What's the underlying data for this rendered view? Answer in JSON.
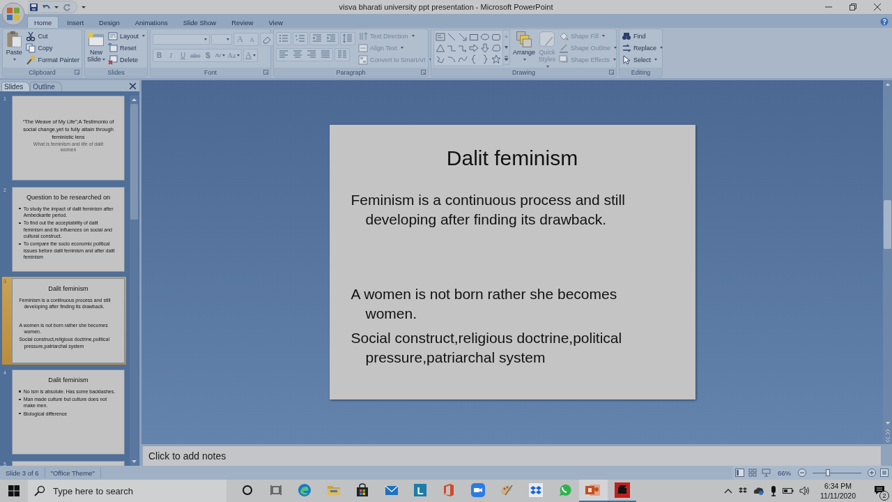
{
  "window": {
    "title": "visva bharati university ppt presentation - Microsoft PowerPoint"
  },
  "ribbon": {
    "tabs": [
      {
        "label": "Home",
        "selected": true
      },
      {
        "label": "Insert",
        "selected": false
      },
      {
        "label": "Design",
        "selected": false
      },
      {
        "label": "Animations",
        "selected": false
      },
      {
        "label": "Slide Show",
        "selected": false
      },
      {
        "label": "Review",
        "selected": false
      },
      {
        "label": "View",
        "selected": false
      }
    ],
    "groups": [
      {
        "name": "Clipboard",
        "kind": "plain",
        "commands": [
          {
            "label": "Paste",
            "kind": "large",
            "dropdown": true,
            "disabled": false
          },
          {
            "label": "Cut",
            "kind": "small",
            "dropdown": false,
            "disabled": false
          },
          {
            "label": "Copy",
            "kind": "small",
            "dropdown": false,
            "disabled": false
          },
          {
            "label": "Format Painter",
            "kind": "small",
            "dropdown": false,
            "disabled": false
          }
        ]
      },
      {
        "name": "Slides",
        "kind": "plain",
        "commands": [
          {
            "label": "New Slide",
            "kind": "large",
            "dropdown": true,
            "disabled": false
          },
          {
            "label": "Layout",
            "kind": "small",
            "dropdown": true,
            "disabled": false
          },
          {
            "label": "Reset",
            "kind": "small",
            "dropdown": false,
            "disabled": false
          },
          {
            "label": "Delete",
            "kind": "small",
            "dropdown": false,
            "disabled": false
          }
        ]
      },
      {
        "name": "Font",
        "kind": "font",
        "commands": [
          {
            "label": "A",
            "kind": "glyph",
            "dropdown": false,
            "disabled": true
          },
          {
            "label": "A",
            "kind": "glyph",
            "dropdown": false,
            "disabled": true
          },
          {
            "label": "B",
            "kind": "glyph",
            "dropdown": false,
            "disabled": true
          },
          {
            "label": "I",
            "kind": "glyph",
            "dropdown": false,
            "disabled": true
          },
          {
            "label": "U",
            "kind": "glyph",
            "dropdown": false,
            "disabled": true
          },
          {
            "label": "abc",
            "kind": "glyph",
            "dropdown": false,
            "disabled": true
          },
          {
            "label": "S",
            "kind": "glyph",
            "dropdown": false,
            "disabled": true
          },
          {
            "label": "AV",
            "kind": "glyph",
            "dropdown": true,
            "disabled": true
          },
          {
            "label": "Aa",
            "kind": "glyph",
            "dropdown": true,
            "disabled": true
          },
          {
            "label": "A",
            "kind": "glyph",
            "dropdown": true,
            "disabled": true
          }
        ]
      },
      {
        "name": "Paragraph",
        "kind": "paragraph",
        "commands": [
          {
            "label": "Text Direction",
            "kind": "small",
            "dropdown": true,
            "disabled": true
          },
          {
            "label": "Align Text",
            "kind": "small",
            "dropdown": true,
            "disabled": true
          },
          {
            "label": "Convert to SmartArt",
            "kind": "small",
            "dropdown": true,
            "disabled": true
          }
        ]
      },
      {
        "name": "Drawing",
        "kind": "drawing",
        "commands": [
          {
            "label": "Arrange",
            "kind": "large",
            "dropdown": true,
            "disabled": false
          },
          {
            "label": "Quick Styles",
            "kind": "large",
            "dropdown": true,
            "disabled": true
          },
          {
            "label": "Shape Fill",
            "kind": "small",
            "dropdown": true,
            "disabled": true
          },
          {
            "label": "Shape Outline",
            "kind": "small",
            "dropdown": true,
            "disabled": true
          },
          {
            "label": "Shape Effects",
            "kind": "small",
            "dropdown": true,
            "disabled": true
          }
        ]
      },
      {
        "name": "Editing",
        "kind": "plain",
        "commands": [
          {
            "label": "Find",
            "kind": "small",
            "dropdown": false,
            "disabled": false
          },
          {
            "label": "Replace",
            "kind": "small",
            "dropdown": true,
            "disabled": false
          },
          {
            "label": "Select",
            "kind": "small",
            "dropdown": true,
            "disabled": false
          }
        ]
      }
    ]
  },
  "slides_pane": {
    "tabs": [
      {
        "label": "Slides",
        "selected": true
      },
      {
        "label": "Outline",
        "selected": false
      }
    ],
    "slides": [
      {
        "number": "1",
        "selected": false,
        "kind": "title",
        "title": "“The Weave of My Life”;A Testimonio of social change,yet to fully attain through feministic lens",
        "subtitle": "What is feminism and life of dalit women"
      },
      {
        "number": "2",
        "selected": false,
        "kind": "content",
        "title": "Question to be researched on",
        "paragraphs": [
          {
            "text": "To study the impact of dalit feminism after Ambedkarite period.",
            "kind": "bullet",
            "gap_before": false
          },
          {
            "text": "To find out the acceptability of dalit feminism and its influences on social and cultural construct.",
            "kind": "bullet",
            "gap_before": false
          },
          {
            "text": "To compare the socio economic political issues before dalit feminism and after dalit feminism",
            "kind": "bullet",
            "gap_before": false
          }
        ]
      },
      {
        "number": "3",
        "selected": true,
        "kind": "content",
        "title": "Dalit feminism",
        "paragraphs": [
          {
            "text": "Feminism is a continuous process and still developing after finding its drawback.",
            "kind": "plain",
            "gap_before": false
          },
          {
            "text": "A women is not born rather she becomes women.",
            "kind": "plain",
            "gap_before": true
          },
          {
            "text": "Social construct,religious doctrine,political pressure,patriarchal system",
            "kind": "plain",
            "gap_before": false
          }
        ]
      },
      {
        "number": "4",
        "selected": false,
        "kind": "content",
        "title": "Dalit feminism",
        "paragraphs": [
          {
            "text": "No ism is absolute. Has some backlashes.",
            "kind": "bullet",
            "gap_before": false
          },
          {
            "text": "Man made culture but culture does not make men.",
            "kind": "bullet",
            "gap_before": false
          },
          {
            "text": "Biological difference",
            "kind": "bullet",
            "gap_before": false
          }
        ]
      },
      {
        "number": "5",
        "selected": false,
        "kind": "partial"
      }
    ]
  },
  "editor": {
    "slide": {
      "kind": "content",
      "title": "Dalit feminism",
      "paragraphs": [
        {
          "text": "Feminism is a continuous process and still developing after finding its drawback.",
          "kind": "plain",
          "gap_before": false
        },
        {
          "text": "A women is not born rather she becomes women.",
          "kind": "plain",
          "gap_before": true
        },
        {
          "text": "Social construct,religious doctrine,political pressure,patriarchal system",
          "kind": "plain",
          "gap_before": false
        }
      ]
    },
    "notes": {
      "placeholder": "Click to add notes"
    }
  },
  "status_bar": {
    "slide_indicator": "Slide 3 of 6",
    "theme": "\"Office Theme\"",
    "zoom": {
      "reading": "66%",
      "level": 0.31
    }
  },
  "taskbar": {
    "search": {
      "placeholder": "Type here to search"
    },
    "apps": [
      {
        "kind": "cortana",
        "active": false,
        "running": false
      },
      {
        "kind": "taskview",
        "active": false,
        "running": false
      },
      {
        "kind": "edge",
        "active": false,
        "running": false
      },
      {
        "kind": "explorer",
        "active": false,
        "running": false
      },
      {
        "kind": "store",
        "active": false,
        "running": false
      },
      {
        "kind": "mail",
        "active": false,
        "running": false
      },
      {
        "kind": "letter",
        "glyph": "L",
        "active": false,
        "running": false
      },
      {
        "kind": "office",
        "active": false,
        "running": false
      },
      {
        "kind": "zoom",
        "active": false,
        "running": false
      },
      {
        "kind": "paint",
        "active": false,
        "running": false
      },
      {
        "kind": "dropbox",
        "active": false,
        "running": false
      },
      {
        "kind": "whatsapp",
        "active": false,
        "running": false
      },
      {
        "kind": "powerpoint",
        "active": true,
        "running": true
      },
      {
        "kind": "recorder",
        "active": false,
        "running": true
      }
    ],
    "clock": {
      "time": "6:34 PM",
      "date": "11/11/2020"
    },
    "notifications": {
      "count": "2"
    }
  }
}
